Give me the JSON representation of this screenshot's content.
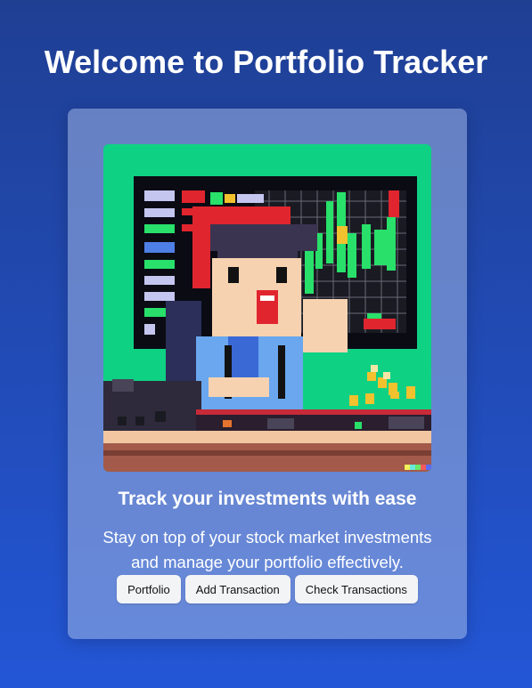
{
  "page": {
    "title": "Welcome to Portfolio Tracker"
  },
  "card": {
    "tagline": "Track your investments with ease",
    "description": "Stay on top of your stock market investments and manage your portfolio effectively.",
    "hero_image": "pixel-art-trader-with-stock-charts"
  },
  "buttons": {
    "portfolio": "Portfolio",
    "add_transaction": "Add Transaction",
    "check_transactions": "Check Transactions"
  },
  "colors": {
    "background_top": "#1f3f93",
    "background_bottom": "#2356d6",
    "hero_green": "#0fd184",
    "button_bg": "#f3f4f6"
  }
}
